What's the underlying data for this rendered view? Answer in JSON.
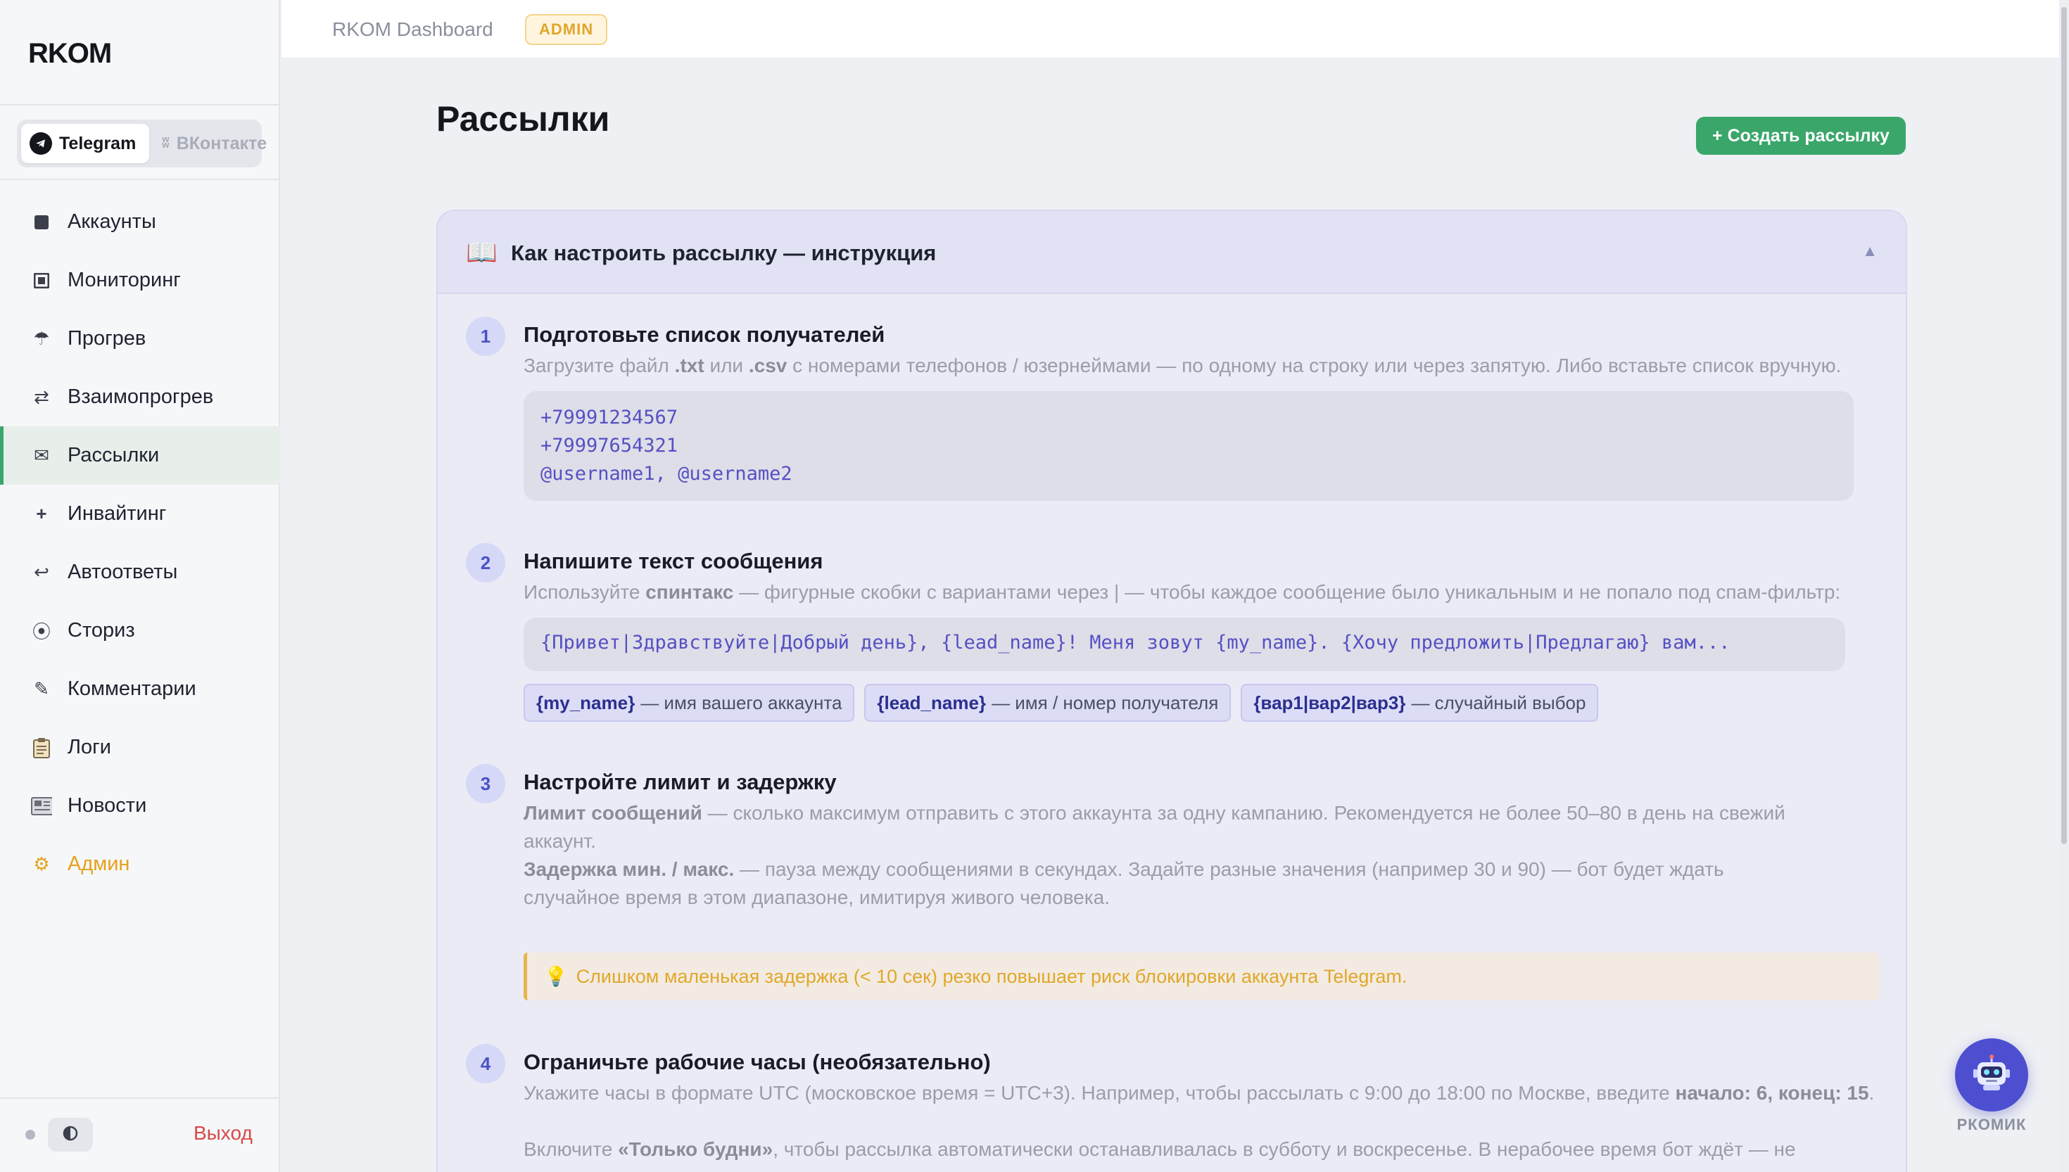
{
  "app": {
    "logo": "RKOM",
    "topbar_title": "RKOM Dashboard",
    "admin_badge": "ADMIN"
  },
  "platforms": [
    {
      "label": "Telegram",
      "icon": "telegram-icon",
      "active": true
    },
    {
      "label": "ВКонтакте",
      "icon": "vk-icon",
      "active": false
    }
  ],
  "nav": [
    {
      "label": "Аккаунты",
      "icon": "square-icon"
    },
    {
      "label": "Мониторинг",
      "icon": "monitor-icon"
    },
    {
      "label": "Прогрев",
      "icon": "umbrella-icon"
    },
    {
      "label": "Взаимопрогрев",
      "icon": "arrows-icon"
    },
    {
      "label": "Рассылки",
      "icon": "envelope-icon",
      "active": true
    },
    {
      "label": "Инвайтинг",
      "icon": "plus-icon"
    },
    {
      "label": "Автоответы",
      "icon": "reply-icon"
    },
    {
      "label": "Сториз",
      "icon": "circle-dot-icon"
    },
    {
      "label": "Комментарии",
      "icon": "pencil-icon"
    },
    {
      "label": "Логи",
      "icon": "clipboard-icon"
    },
    {
      "label": "Новости",
      "icon": "newspaper-icon"
    },
    {
      "label": "Админ",
      "icon": "gear-icon"
    }
  ],
  "footer": {
    "logout": "Выход"
  },
  "page": {
    "title": "Рассылки",
    "create_button": "+ Создать рассылку"
  },
  "guide": {
    "title": "Как настроить рассылку — инструкция",
    "collapse_symbol": "▲",
    "steps": [
      {
        "num": "1",
        "title": "Подготовьте список получателей",
        "text_parts": [
          "Загрузите файл ",
          ".txt",
          " или ",
          ".csv",
          " с номерами телефонов / юзернеймами — по одному на строку или через запятую. Либо вставьте список вручную."
        ],
        "code_lines": [
          "+79991234567",
          "+79997654321",
          "@username1, @username2"
        ]
      },
      {
        "num": "2",
        "title": "Напишите текст сообщения",
        "text_parts": [
          "Используйте ",
          "спинтакс",
          " — фигурные скобки с вариантами через | — чтобы каждое сообщение было уникальным и не попало под спам-фильтр:"
        ],
        "code": "{Привет|Здравствуйте|Добрый день}, {lead_name}! Меня зовут {my_name}. {Хочу предложить|Предлагаю} вам...",
        "chips": [
          {
            "key": "{my_name}",
            "desc": "— имя вашего аккаунта"
          },
          {
            "key": "{lead_name}",
            "desc": "— имя / номер получателя"
          },
          {
            "key": "{вар1|вар2|вар3}",
            "desc": "— случайный выбор"
          }
        ]
      },
      {
        "num": "3",
        "title": "Настройте лимит и задержку",
        "p1_bold": "Лимит сообщений",
        "p1_rest": " — сколько максимум отправить с этого аккаунта за одну кампанию. Рекомендуется не более 50–80 в день на свежий аккаунт.",
        "p2_bold": "Задержка мин. / макс.",
        "p2_rest": " — пауза между сообщениями в секундах. Задайте разные значения (например 30 и 90) — бот будет ждать случайное время в этом диапазоне, имитируя живого человека.",
        "warning": "Слишком маленькая задержка (< 10 сек) резко повышает риск блокировки аккаунта Telegram."
      },
      {
        "num": "4",
        "title": "Ограничьте рабочие часы (необязательно)",
        "p1": "Укажите часы в формате UTC (московское время = UTC+3). Например, чтобы рассылать с 9:00 до 18:00 по Москве, введите ",
        "p1_bold": "начало: 6, конец: 15",
        "p1_end": ".",
        "p2_start": "Включите ",
        "p2_bold": "«Только будни»",
        "p2_rest": ", чтобы рассылка автоматически останавливалась в субботу и воскресенье. В нерабочее время бот ждёт — не"
      }
    ]
  },
  "bot_widget": {
    "label": "РКОМИК",
    "icon": "robot-icon"
  },
  "colors": {
    "accent_green": "#3aa66a",
    "admin_yellow": "#e5a21a",
    "guide_purple": "#4a52c4",
    "logout_red": "#d94848"
  }
}
